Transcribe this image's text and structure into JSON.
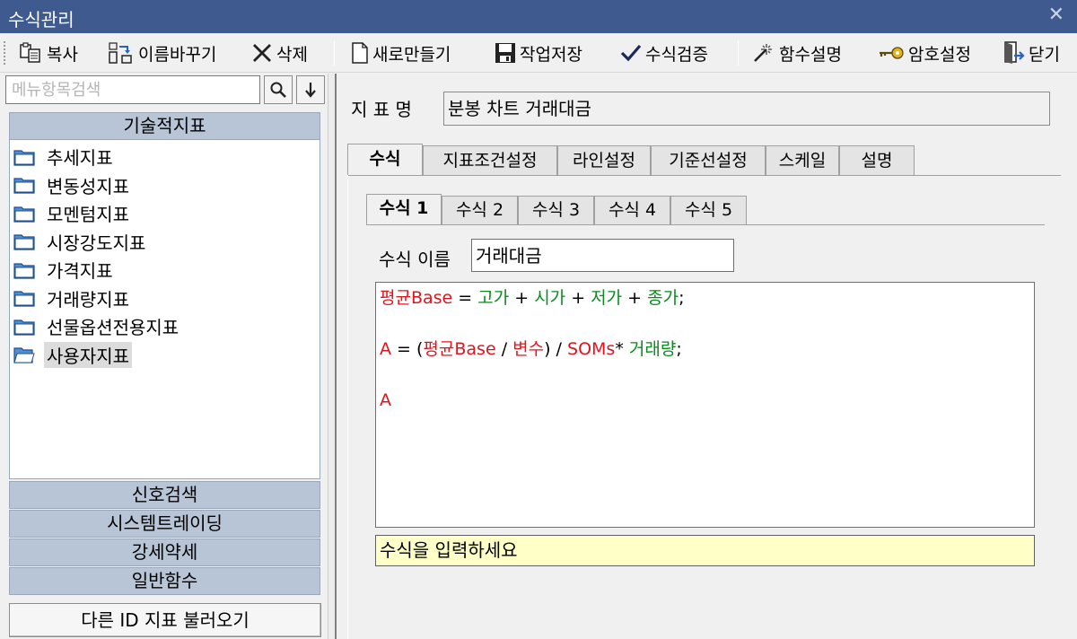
{
  "window": {
    "title": "수식관리",
    "close_glyph": "✕"
  },
  "toolbar": {
    "copy": "복사",
    "rename": "이름바꾸기",
    "delete": "삭제",
    "new": "새로만들기",
    "save": "작업저장",
    "verify": "수식검증",
    "func_help": "함수설명",
    "password": "암호설정",
    "close": "닫기"
  },
  "sidebar": {
    "search_placeholder": "메뉴항목검색",
    "categories": {
      "technical": "기술적지표",
      "signal": "신호검색",
      "system": "시스템트레이딩",
      "strength": "강세약세",
      "general": "일반함수"
    },
    "items": [
      "추세지표",
      "변동성지표",
      "모멘텀지표",
      "시장강도지표",
      "가격지표",
      "거래량지표",
      "선물옵션전용지표",
      "사용자지표"
    ],
    "selected_index": 7,
    "load_button": "다른 ID 지표 불러오기"
  },
  "main": {
    "indicator_label": "지 표 명",
    "indicator_name": "분봉 차트 거래대금",
    "tabs": [
      "수식",
      "지표조건설정",
      "라인설정",
      "기준선설정",
      "스케일",
      "설명"
    ],
    "active_tab": 0,
    "formula_tabs": [
      "수식 1",
      "수식 2",
      "수식 3",
      "수식 4",
      "수식 5"
    ],
    "active_formula_tab": 0,
    "formula_name_label": "수식 이름",
    "formula_name": "거래대금",
    "editor": {
      "line1": {
        "a": "평균Base",
        "b": " = ",
        "c": "고가",
        "d": " + ",
        "e": "시가",
        "f": " + ",
        "g": "저가",
        "h": " + ",
        "i": "종가",
        "j": ";"
      },
      "line2": {
        "a": "A",
        "b": " = (",
        "c": "평균Base",
        "d": " / ",
        "e": "변수",
        "f": ") / ",
        "g": "SOMs",
        "h": "* ",
        "i": "거래량",
        "j": ";"
      },
      "line3": {
        "a": "A"
      }
    },
    "hint": "수식을 입력하세요"
  },
  "colors": {
    "titlebar": "#3f5a8f",
    "category": "#b8c5d6",
    "keyword_red": "#e0141e",
    "keyword_green": "#0a8a1f",
    "hint_bg": "#ffffc8"
  }
}
